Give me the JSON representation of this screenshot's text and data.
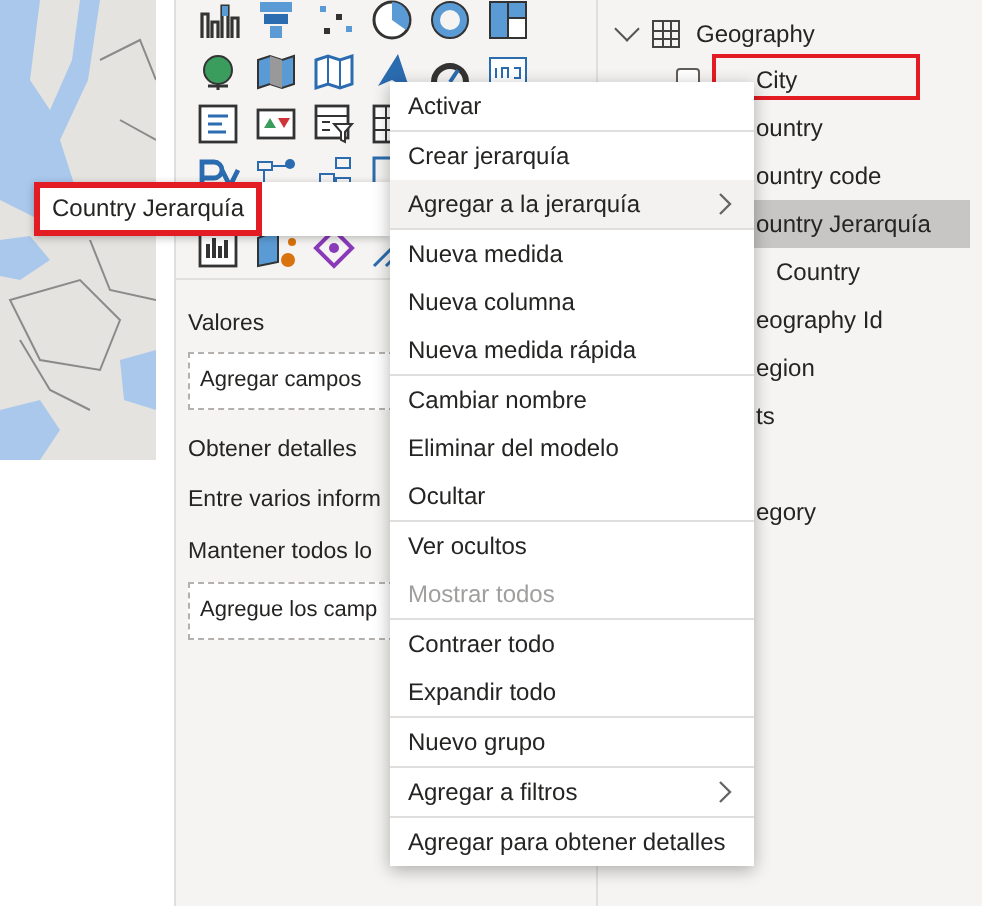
{
  "build_panel": {
    "wells": [
      {
        "kind": "heading",
        "text": "Valores"
      },
      {
        "kind": "drop",
        "text": "Agregar campos"
      },
      {
        "kind": "heading",
        "text": "Obtener detalles"
      },
      {
        "kind": "option",
        "text": "Entre varios inform"
      },
      {
        "kind": "option",
        "text": "Mantener todos lo"
      },
      {
        "kind": "drop",
        "text": "Agregue los camp"
      }
    ]
  },
  "drag_preview": {
    "label": "Country Jerarquía",
    "highlighted": true
  },
  "fields": {
    "table": "Geography",
    "expanded": true,
    "items": [
      {
        "kind": "field",
        "label": "City",
        "checked": false,
        "highlighted": true,
        "selected": false
      },
      {
        "kind": "field",
        "label": "ountry",
        "highlighted": false,
        "selected": false
      },
      {
        "kind": "field",
        "label": "ountry code",
        "highlighted": false,
        "selected": false
      },
      {
        "kind": "field",
        "label": "ountry Jerarquía",
        "highlighted": false,
        "selected": true,
        "children": [
          {
            "label": "Country"
          }
        ]
      },
      {
        "kind": "field",
        "label": "eography Id",
        "highlighted": false,
        "selected": false
      },
      {
        "kind": "field",
        "label": "egion",
        "highlighted": false,
        "selected": false
      },
      {
        "kind": "field",
        "label": "ts",
        "highlighted": false,
        "selected": false
      },
      {
        "kind": "table",
        "label": "egory",
        "highlighted": false,
        "selected": false
      }
    ]
  },
  "context_menu": {
    "groups": [
      [
        {
          "label": "Activar",
          "submenu": false,
          "disabled": false,
          "selected": false
        }
      ],
      [
        {
          "label": "Crear jerarquía",
          "submenu": false,
          "disabled": false,
          "selected": false
        },
        {
          "label": "Agregar a la jerarquía",
          "submenu": true,
          "disabled": false,
          "selected": true
        }
      ],
      [
        {
          "label": "Nueva medida",
          "submenu": false,
          "disabled": false,
          "selected": false
        },
        {
          "label": "Nueva columna",
          "submenu": false,
          "disabled": false,
          "selected": false
        },
        {
          "label": "Nueva medida rápida",
          "submenu": false,
          "disabled": false,
          "selected": false
        }
      ],
      [
        {
          "label": "Cambiar nombre",
          "submenu": false,
          "disabled": false,
          "selected": false
        },
        {
          "label": "Eliminar del modelo",
          "submenu": false,
          "disabled": false,
          "selected": false
        },
        {
          "label": "Ocultar",
          "submenu": false,
          "disabled": false,
          "selected": false
        }
      ],
      [
        {
          "label": "Ver ocultos",
          "submenu": false,
          "disabled": false,
          "selected": false
        },
        {
          "label": "Mostrar todos",
          "submenu": false,
          "disabled": true,
          "selected": false
        }
      ],
      [
        {
          "label": "Contraer todo",
          "submenu": false,
          "disabled": false,
          "selected": false
        },
        {
          "label": "Expandir todo",
          "submenu": false,
          "disabled": false,
          "selected": false
        }
      ],
      [
        {
          "label": "Nuevo grupo",
          "submenu": false,
          "disabled": false,
          "selected": false
        }
      ],
      [
        {
          "label": "Agregar a filtros",
          "submenu": true,
          "disabled": false,
          "selected": false
        }
      ],
      [
        {
          "label": "Agregar para obtener detalles",
          "submenu": false,
          "disabled": false,
          "selected": false
        }
      ]
    ]
  }
}
